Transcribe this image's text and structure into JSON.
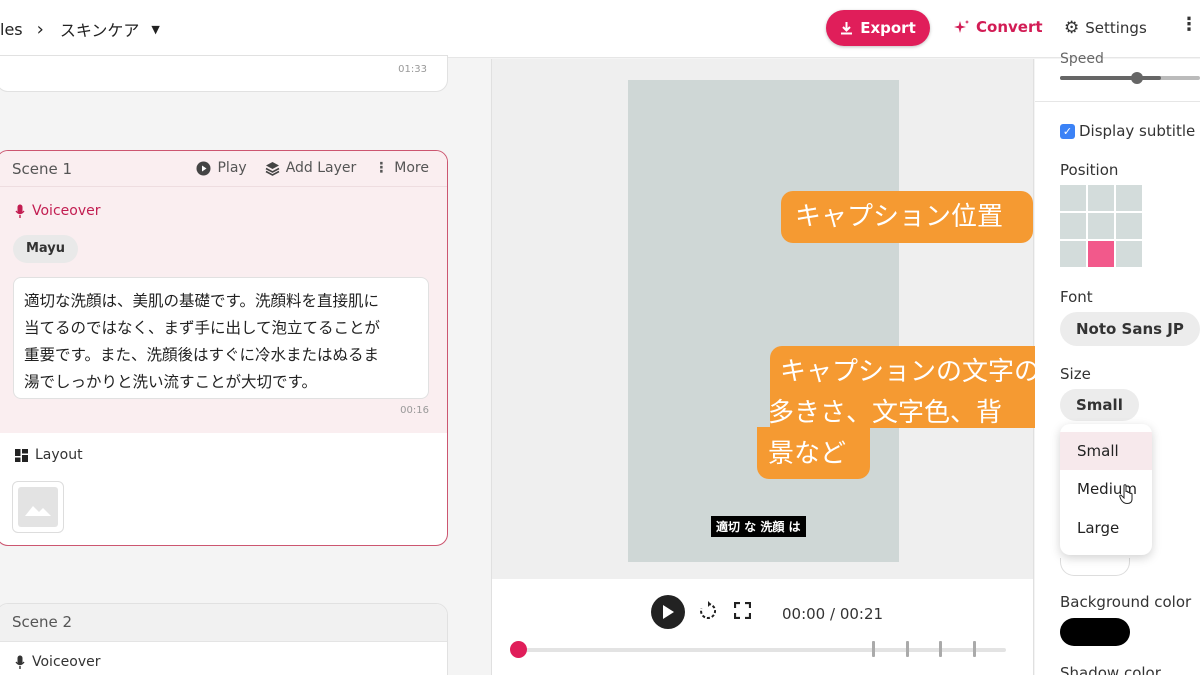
{
  "header": {
    "breadcrumb_parent": "les",
    "breadcrumb_separator": "›",
    "breadcrumb_current": "スキンケア",
    "export_label": "Export",
    "convert_label": "Convert",
    "settings_label": "Settings",
    "accent_color": "#e01e5a"
  },
  "left": {
    "previous_scene_duration": "01:33",
    "scene1": {
      "title": "Scene 1",
      "play_label": "Play",
      "add_layer_label": "Add Layer",
      "more_label": "More",
      "voiceover_label": "Voiceover",
      "voice_name": "Mayu",
      "script_lines": [
        "適切な洗顔は、美肌の基礎です。洗顔料を直接肌に",
        "当てるのではなく、まず手に出して泡立てることが",
        "重要です。また、洗顔後はすぐに冷水またはぬるま",
        "湯でしっかりと洗い流すことが大切です。"
      ],
      "duration": "00:16",
      "layout_label": "Layout"
    },
    "scene2": {
      "title": "Scene 2",
      "voiceover_label": "Voiceover"
    }
  },
  "preview": {
    "subtitle": "適切 な 洗顔 は",
    "time": "00:00 / 00:21"
  },
  "callouts": {
    "position": "キャプション位置",
    "style_lines": [
      "キャプションの文字の",
      "多きさ、文字色、背",
      "景など"
    ],
    "color": "#f59a32"
  },
  "right": {
    "speed_label": "Speed",
    "display_subtitle_label": "Display subtitle",
    "display_subtitle_checked": true,
    "position_label": "Position",
    "font_label": "Font",
    "font_value": "Noto Sans JP",
    "size_label": "Size",
    "size_value": "Small",
    "size_options": [
      "Small",
      "Medium",
      "Large"
    ],
    "background_color_label": "Background color",
    "background_color_value": "#000000",
    "shadow_color_label": "Shadow color"
  }
}
